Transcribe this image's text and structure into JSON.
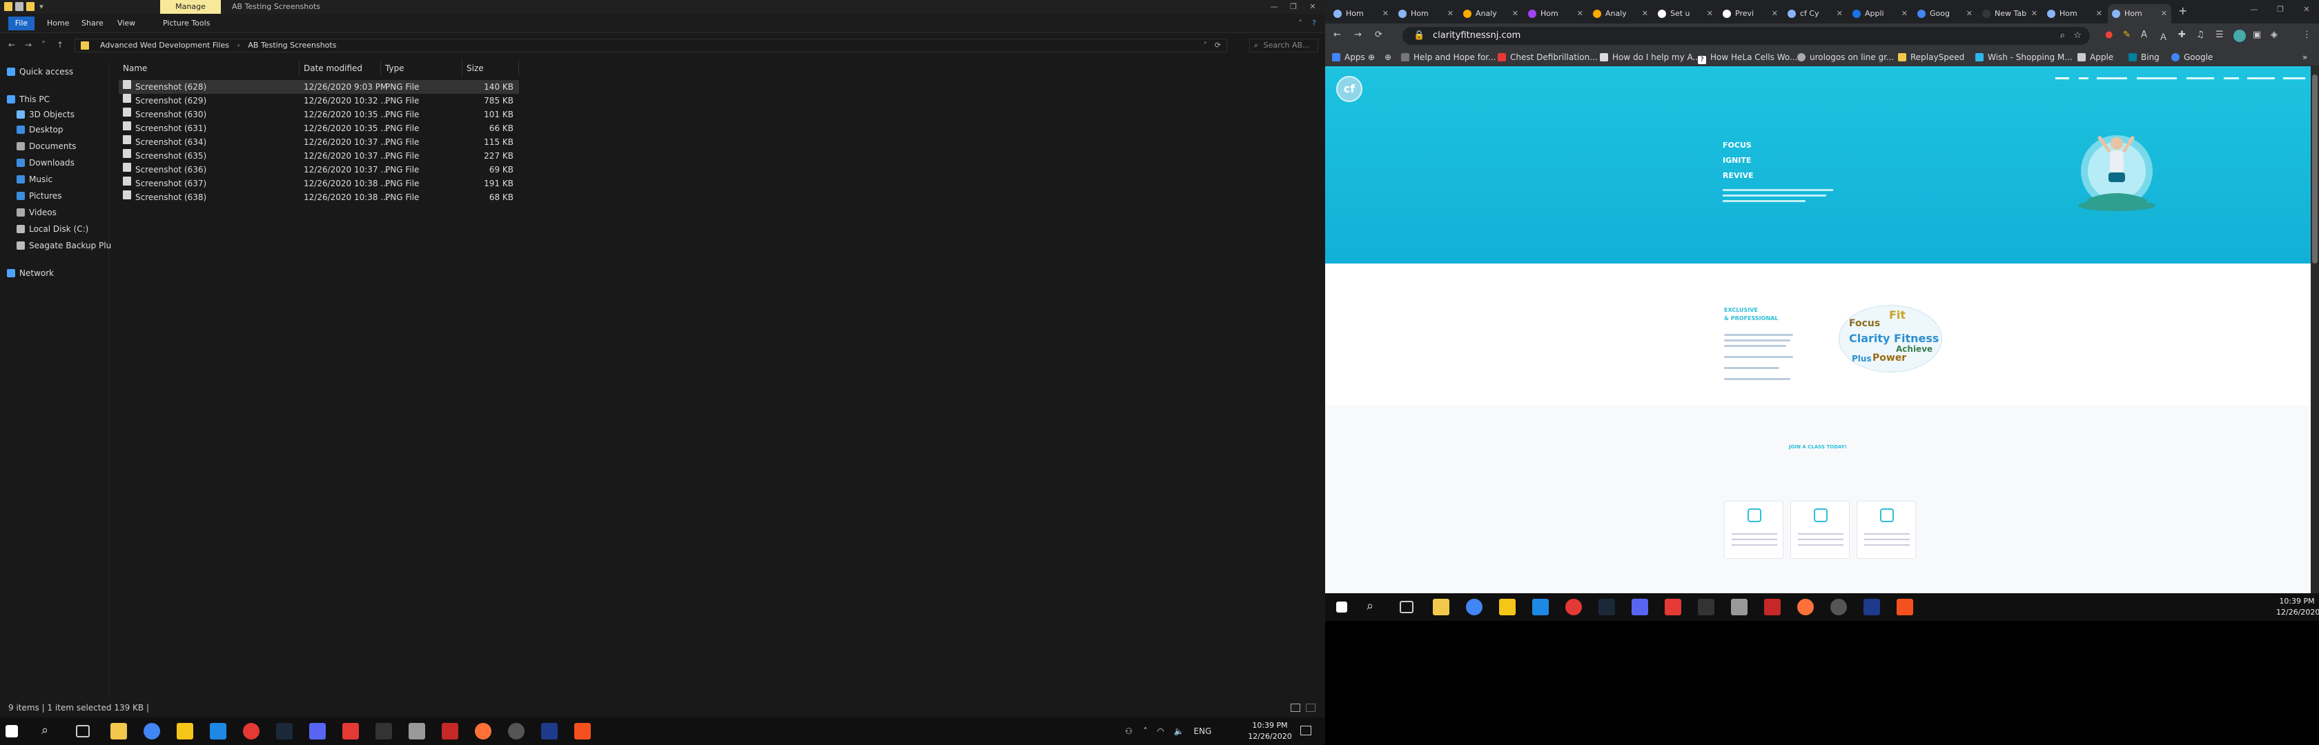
{
  "explorer": {
    "ribbon": {
      "manage": "Manage",
      "title": "AB Testing Screenshots",
      "tabs": [
        "File",
        "Home",
        "Share",
        "View",
        "Picture Tools"
      ]
    },
    "breadcrumb": [
      "Advanced Wed Development Files",
      "AB Testing Screenshots"
    ],
    "search_placeholder": "Search AB...",
    "nav": [
      "Quick access",
      "This PC",
      "3D Objects",
      "Desktop",
      "Documents",
      "Downloads",
      "Music",
      "Pictures",
      "Videos",
      "Local Disk (C:)",
      "Seagate Backup Plu",
      "Network"
    ],
    "columns": [
      "Name",
      "Date modified",
      "Type",
      "Size"
    ],
    "files": [
      {
        "name": "Screenshot (628)",
        "date": "12/26/2020 9:03 PM",
        "type": "PNG File",
        "size": "140 KB",
        "selected": true
      },
      {
        "name": "Screenshot (629)",
        "date": "12/26/2020 10:32 ...",
        "type": "PNG File",
        "size": "785 KB"
      },
      {
        "name": "Screenshot (630)",
        "date": "12/26/2020 10:35 ...",
        "type": "PNG File",
        "size": "101 KB"
      },
      {
        "name": "Screenshot (631)",
        "date": "12/26/2020 10:35 ...",
        "type": "PNG File",
        "size": "66 KB"
      },
      {
        "name": "Screenshot (634)",
        "date": "12/26/2020 10:37 ...",
        "type": "PNG File",
        "size": "115 KB"
      },
      {
        "name": "Screenshot (635)",
        "date": "12/26/2020 10:37 ...",
        "type": "PNG File",
        "size": "227 KB"
      },
      {
        "name": "Screenshot (636)",
        "date": "12/26/2020 10:37 ...",
        "type": "PNG File",
        "size": "69 KB"
      },
      {
        "name": "Screenshot (637)",
        "date": "12/26/2020 10:38 ...",
        "type": "PNG File",
        "size": "191 KB"
      },
      {
        "name": "Screenshot (638)",
        "date": "12/26/2020 10:38 ...",
        "type": "PNG File",
        "size": "68 KB"
      }
    ],
    "status": "9 items  |  1 item selected  139 KB  |"
  },
  "taskbar": {
    "tray": "ENG",
    "time": "10:39 PM",
    "date": "12/26/2020"
  },
  "chrome": {
    "tabs": [
      {
        "label": "Hom",
        "color": "#8ab4f8"
      },
      {
        "label": "Hom",
        "color": "#8ab4f8"
      },
      {
        "label": "Analy",
        "color": "#f9ab00"
      },
      {
        "label": "Hom",
        "color": "#a142f4"
      },
      {
        "label": "Analy",
        "color": "#f9ab00"
      },
      {
        "label": "Set u",
        "color": "#ffffff"
      },
      {
        "label": "Previ",
        "color": "#ffffff"
      },
      {
        "label": "cf Cy",
        "color": "#8ab4f8"
      },
      {
        "label": "Appli",
        "color": "#1a73e8"
      },
      {
        "label": "Goog",
        "color": "#4285f4"
      },
      {
        "label": "New Tab",
        "color": "#35363a"
      },
      {
        "label": "Hom",
        "color": "#8ab4f8"
      },
      {
        "label": "Hom",
        "color": "#8ab4f8"
      }
    ],
    "url": "clarityfitnessnj.com",
    "bookmarks": [
      "Apps",
      "Help and Hope for...",
      "Chest Defibrillation...",
      "How do I help my A...",
      "How HeLa Cells Wo...",
      "urologos on line gr...",
      "ReplaySpeed",
      "Wish - Shopping M...",
      "Apple",
      "Bing",
      "Google"
    ],
    "site": {
      "logo": "cf",
      "hero_words": [
        "FOCUS",
        "IGNITE",
        "REVIVE"
      ],
      "section2_title": [
        "EXCLUSIVE",
        "& PROFESSIONAL"
      ],
      "cloud_words": [
        "Fit",
        "Focus",
        "Clarity Fitness",
        "Achieve",
        "Power",
        "Plus"
      ],
      "join": "JOIN A CLASS TODAY!"
    }
  },
  "taskbar2": {
    "time": "10:39 PM",
    "date": "12/26/2020"
  }
}
